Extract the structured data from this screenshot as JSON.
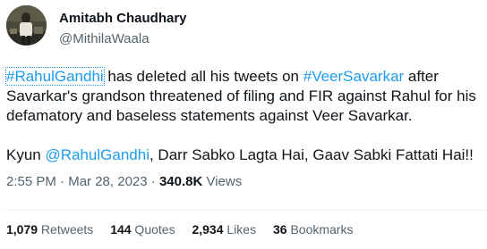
{
  "author": {
    "display_name": "Amitabh Chaudhary",
    "handle": "@MithilaWaala"
  },
  "tweet": {
    "para1": {
      "hashtag1": "#RahulGandhi",
      "text1": " has deleted all his tweets on ",
      "hashtag2": "#VeerSavarkar",
      "text2": " after Savarkar's grandson threatened of filing and FIR against Rahul for his defamatory and baseless statements against Veer Savarkar."
    },
    "para2": {
      "text1": "Kyun ",
      "mention": "@RahulGandhi",
      "text2": ", Darr Sabko Lagta Hai, Gaav Sabki Fattati Hai!!"
    }
  },
  "meta": {
    "time": "2:55 PM",
    "separator": " · ",
    "date": "Mar 28, 2023",
    "views_count": "340.8K",
    "views_label": " Views"
  },
  "stats": {
    "retweets_count": "1,079",
    "retweets_label": " Retweets",
    "quotes_count": "144",
    "quotes_label": " Quotes",
    "likes_count": "2,934",
    "likes_label": " Likes",
    "bookmarks_count": "36",
    "bookmarks_label": " Bookmarks"
  },
  "colors": {
    "link": "#1d9bf0",
    "text": "#0f1419",
    "secondary": "#536471",
    "divider": "#eff3f4"
  }
}
